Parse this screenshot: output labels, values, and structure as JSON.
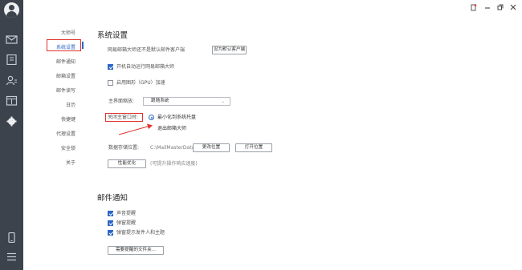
{
  "rail": {
    "icons": [
      "avatar-icon",
      "mail-icon",
      "contacts-icon",
      "user-icon",
      "calendar-icon",
      "settings-icon",
      "phone-icon",
      "menu-icon"
    ]
  },
  "window": {
    "controls": [
      "minimize",
      "restore",
      "close"
    ]
  },
  "nav": {
    "items": [
      {
        "label": "大师号"
      },
      {
        "label": "系统设置"
      },
      {
        "label": "邮件通知"
      },
      {
        "label": "邮箱设置"
      },
      {
        "label": "邮件读写"
      },
      {
        "label": "日历"
      },
      {
        "label": "快捷键"
      },
      {
        "label": "代理设置"
      },
      {
        "label": "安全锁"
      },
      {
        "label": "关于"
      }
    ],
    "active_index": 1
  },
  "system": {
    "title": "系统设置",
    "default_client_text": "网易邮箱大师还不是默认邮件客户端",
    "set_default_button": "设为默认客户端",
    "autostart_label": "开机自动运行网易邮箱大师",
    "gpu_label": "启用图形（GPU）加速",
    "scale_label": "主界面缩放:",
    "scale_value": "跟随系统",
    "close_label": "关闭主窗口时:",
    "close_option_1": "最小化到系统托盘",
    "close_option_2": "退出邮箱大师",
    "storage_label": "数据存储位置:",
    "storage_path": "C:\\MailMasterData",
    "change_location_button": "更改位置",
    "open_location_button": "打开位置",
    "optimize_button": "性能优化",
    "optimize_hint": "(可提升操作响应速度)"
  },
  "notify": {
    "title": "邮件通知",
    "sound_label": "声音提醒",
    "popup_label": "弹窗提醒",
    "popup_sender_label": "弹窗提示发件人和主题",
    "folders_button": "需要提醒的文件夹..."
  },
  "colors": {
    "rail": "#3c434d",
    "accent": "#2b66c7",
    "highlight": "#e0332d"
  }
}
